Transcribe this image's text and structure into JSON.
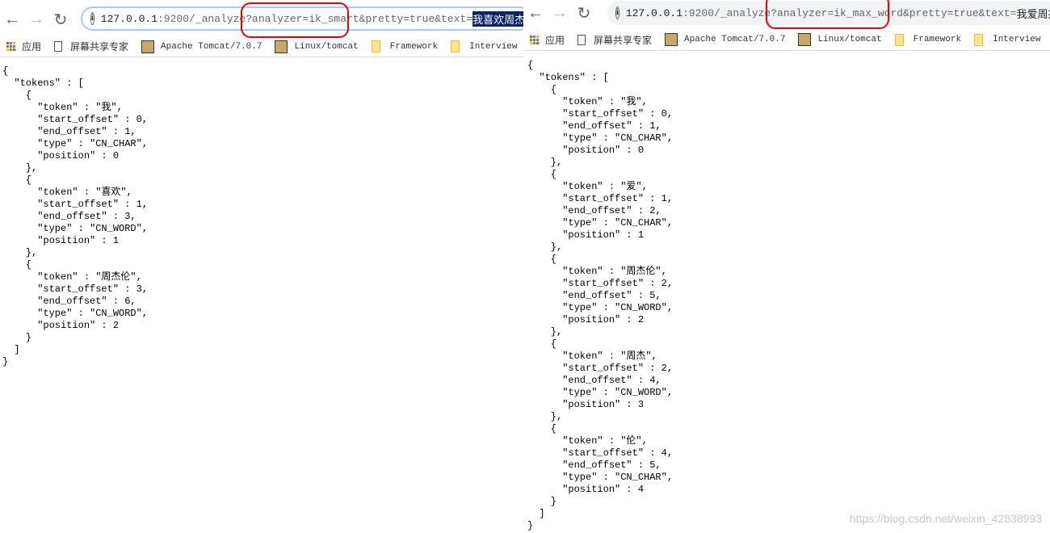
{
  "left": {
    "url": {
      "host": "127.0.0.1",
      "rest": ":9200/_analyze?analyzer=ik_smart&pretty=true&text=",
      "query_text": "我喜欢周杰伦"
    },
    "output": "{\n  \"tokens\" : [\n    {\n      \"token\" : \"我\",\n      \"start_offset\" : 0,\n      \"end_offset\" : 1,\n      \"type\" : \"CN_CHAR\",\n      \"position\" : 0\n    },\n    {\n      \"token\" : \"喜欢\",\n      \"start_offset\" : 1,\n      \"end_offset\" : 3,\n      \"type\" : \"CN_WORD\",\n      \"position\" : 1\n    },\n    {\n      \"token\" : \"周杰伦\",\n      \"start_offset\" : 3,\n      \"end_offset\" : 6,\n      \"type\" : \"CN_WORD\",\n      \"position\" : 2\n    }\n  ]\n}"
  },
  "right": {
    "url": {
      "host": "127.0.0.1",
      "rest": ":9200/_analyze?analyzer=ik_max_word&pretty=true&text=",
      "query_text": "我爱周杰伦"
    },
    "output": "{\n  \"tokens\" : [\n    {\n      \"token\" : \"我\",\n      \"start_offset\" : 0,\n      \"end_offset\" : 1,\n      \"type\" : \"CN_CHAR\",\n      \"position\" : 0\n    },\n    {\n      \"token\" : \"爱\",\n      \"start_offset\" : 1,\n      \"end_offset\" : 2,\n      \"type\" : \"CN_CHAR\",\n      \"position\" : 1\n    },\n    {\n      \"token\" : \"周杰伦\",\n      \"start_offset\" : 2,\n      \"end_offset\" : 5,\n      \"type\" : \"CN_WORD\",\n      \"position\" : 2\n    },\n    {\n      \"token\" : \"周杰\",\n      \"start_offset\" : 2,\n      \"end_offset\" : 4,\n      \"type\" : \"CN_WORD\",\n      \"position\" : 3\n    },\n    {\n      \"token\" : \"伦\",\n      \"start_offset\" : 4,\n      \"end_offset\" : 5,\n      \"type\" : \"CN_CHAR\",\n      \"position\" : 4\n    }\n  ]\n}"
  },
  "bookmarks": [
    "应用",
    "屏幕共享专家",
    "Apache Tomcat/7.0.7",
    "Linux/tomcat",
    "Framework",
    "Interview"
  ],
  "watermark": "https://blog.csdn.net/weixin_42838993",
  "colors": {
    "highlight_circle": "#e00000",
    "selection": "#0a246a"
  }
}
